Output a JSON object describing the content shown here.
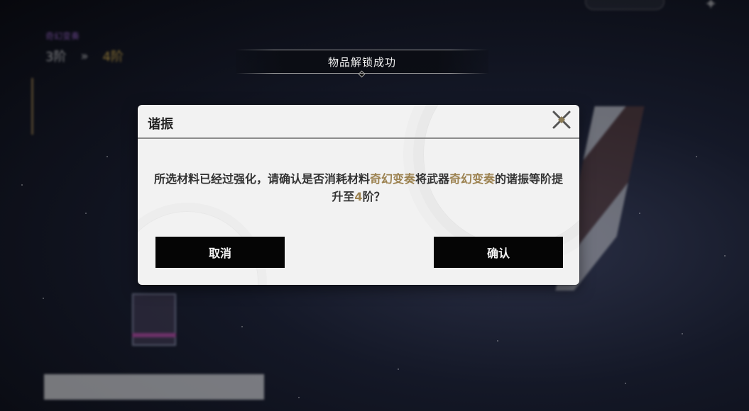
{
  "toast": {
    "text": "物品解锁成功"
  },
  "dialog": {
    "title": "谐振",
    "message": {
      "part1": "所选材料已经过强化，请确认是否消耗材料",
      "material": "奇幻变奏",
      "part2": "将武器",
      "weapon": "奇幻变奏",
      "part3": "的谐振等阶提升至",
      "level": "4",
      "part4": "阶？"
    },
    "cancel_label": "取消",
    "confirm_label": "确认"
  },
  "background": {
    "weapon_name": "奇幻变奏",
    "level_from": "3阶",
    "level_to": "4阶"
  },
  "colors": {
    "highlight": "#9c8250",
    "dialog_bg": "#f2f2f2",
    "button_bg": "#050505"
  },
  "icons": {
    "close": "close-x-icon"
  }
}
